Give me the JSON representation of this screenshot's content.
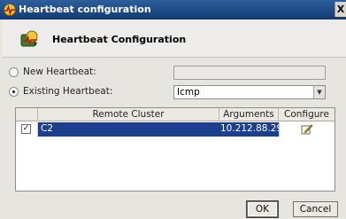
{
  "window": {
    "title": "Heartbeat configuration",
    "close_glyph": "X"
  },
  "header": {
    "title": "Heartbeat Configuration"
  },
  "form": {
    "new_heartbeat_label": "New Heartbeat:",
    "new_heartbeat_value": "",
    "existing_heartbeat_label": "Existing Heartbeat:",
    "existing_heartbeat_selected": "Icmp",
    "selected_option": "existing"
  },
  "table": {
    "columns": [
      "",
      "Remote Cluster",
      "Arguments",
      "Configure"
    ],
    "rows": [
      {
        "checked": true,
        "remote_cluster": "C2",
        "arguments": "10.212.88.29",
        "configure_icon": "edit-icon"
      }
    ]
  },
  "buttons": {
    "ok": "OK",
    "cancel": "Cancel"
  },
  "icons": {
    "app": "heartbeat-app-icon",
    "header": "heartbeat-config-icon",
    "select_arrow": "chevron-down-icon",
    "check": "checkmark-icon"
  },
  "colors": {
    "title_bar": "#1b4785",
    "selection": "#1c3f8d",
    "dialog_bg": "#e7e5df"
  },
  "glyphs": {
    "check": "✓",
    "dropdown": "▼"
  }
}
